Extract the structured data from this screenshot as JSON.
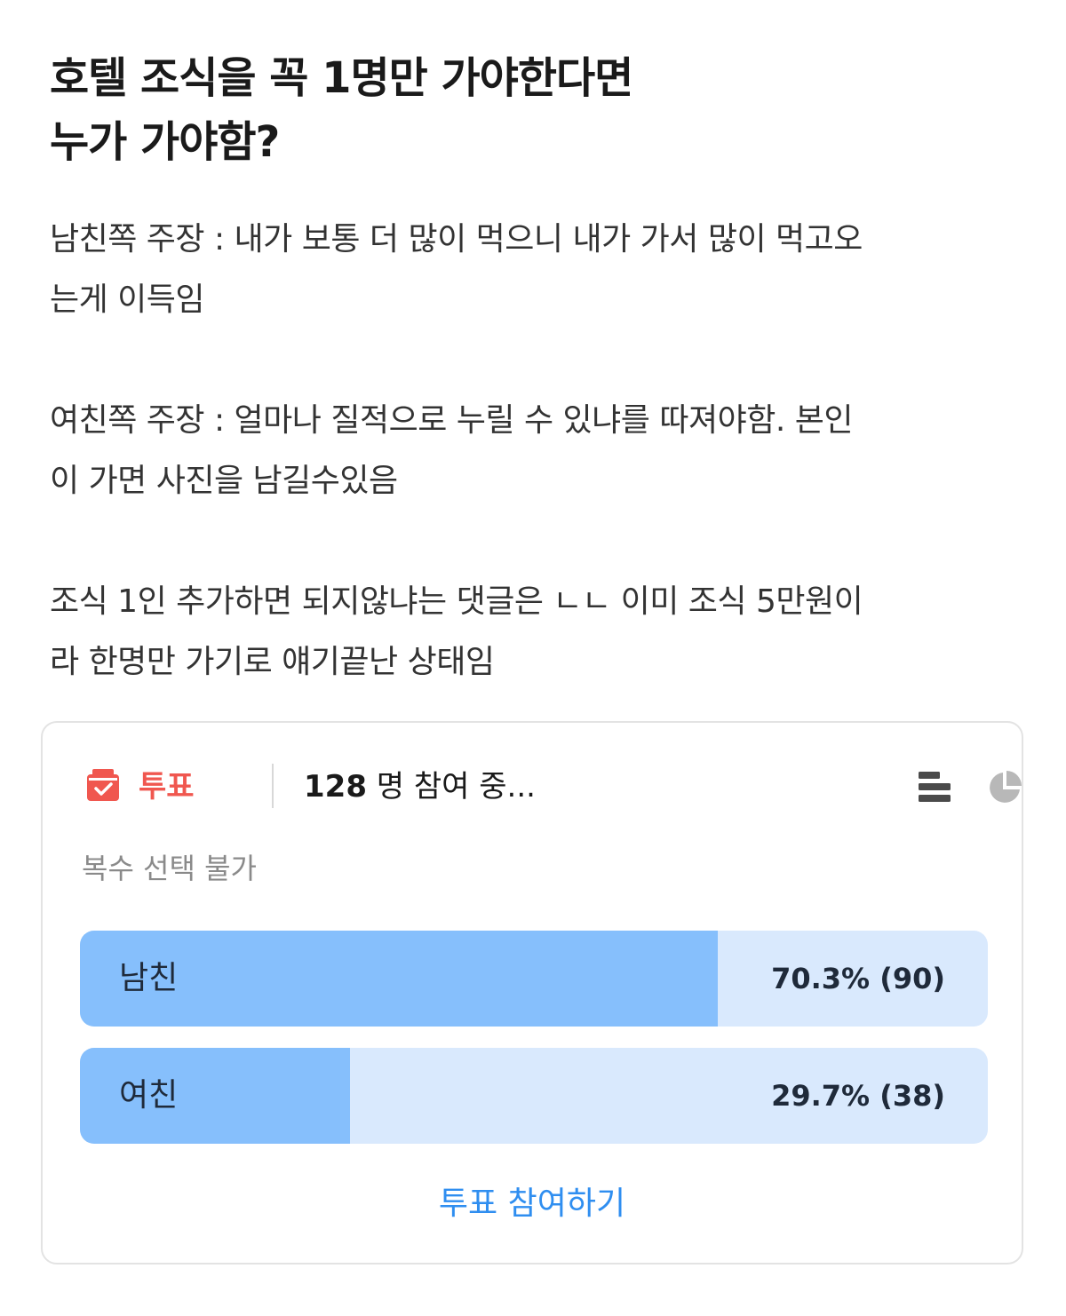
{
  "post": {
    "title_lines": [
      "호텔 조식을 꼭 1명만 가야한다면",
      "누가 가야함?"
    ],
    "paragraphs": [
      [
        "남친쪽 주장 : 내가 보통 더 많이 먹으니 내가 가서 많이 먹고오",
        "는게 이득임"
      ],
      [
        "여친쪽 주장 : 얼마나 질적으로 누릴 수 있냐를 따져야함. 본인",
        "이 가면 사진을 남길수있음"
      ],
      [
        "조식 1인 추가하면 되지않냐는 댓글은 ㄴㄴ 이미 조식 5만원이",
        "라 한명만 가기로 얘기끝난 상태임"
      ]
    ]
  },
  "poll": {
    "label": "투표",
    "participants_count": "128",
    "participants_suffix": " 명 참여 중...",
    "mode": "복수 선택 불가",
    "view_icons": [
      "bar-chart-icon",
      "pie-chart-icon"
    ],
    "options": [
      {
        "label": "남친",
        "percent": 70.3,
        "result": "70.3% (90)"
      },
      {
        "label": "여친",
        "percent": 29.7,
        "result": "29.7% (38)"
      }
    ],
    "participate_label": "투표 참여하기"
  },
  "colors": {
    "vote_accent": "#f0574f",
    "bar_fill": "#86bffc",
    "bar_track": "#d9e9fd",
    "link_blue": "#2f8ef0",
    "muted_gray": "#8a8a8a",
    "icon_dark": "#4a4a4a",
    "icon_light": "#b8b8b8"
  }
}
